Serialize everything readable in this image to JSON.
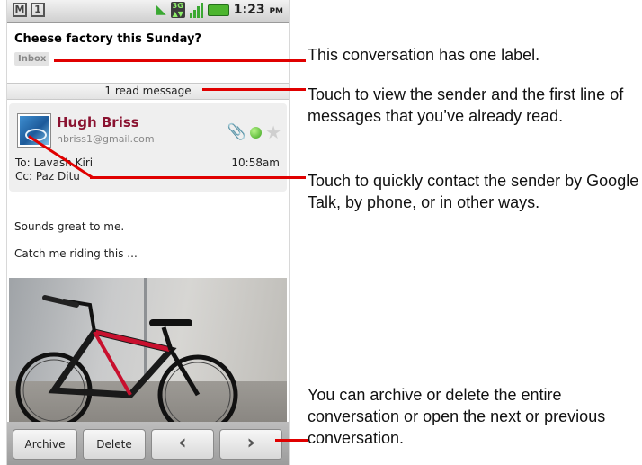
{
  "status_bar": {
    "time": "1:23",
    "ampm": "PM",
    "icons": [
      "gmail-icon",
      "notification-icon",
      "sync-icon",
      "3g-icon",
      "signal-icon",
      "battery-icon"
    ]
  },
  "conversation": {
    "subject": "Cheese factory this Sunday?",
    "label": "Inbox",
    "read_messages": "1 read message"
  },
  "message": {
    "sender_name": "Hugh Briss",
    "sender_email": "hbriss1@gmail.com",
    "to": "To: Lavash Kiri",
    "cc": "Cc: Paz Ditu",
    "time": "10:58am",
    "body_lines": [
      "Sounds great to me.",
      "Catch me riding this ..."
    ],
    "status_color": "#3aa31c"
  },
  "toolbar": {
    "archive_label": "Archive",
    "delete_label": "Delete",
    "prev_label": "‹",
    "next_label": "›"
  },
  "callouts": {
    "label": "This conversation has one label.",
    "read": "Touch to view the sender and the first line of messages that you’ve already read.",
    "contact": "Touch to quickly contact the sender by Google Talk, by phone, or in other ways.",
    "archive": "You can archive or delete the entire conversation or open the next or previous conversation."
  },
  "colors": {
    "leader_line": "#e00000",
    "sender_name": "#8a1230"
  }
}
